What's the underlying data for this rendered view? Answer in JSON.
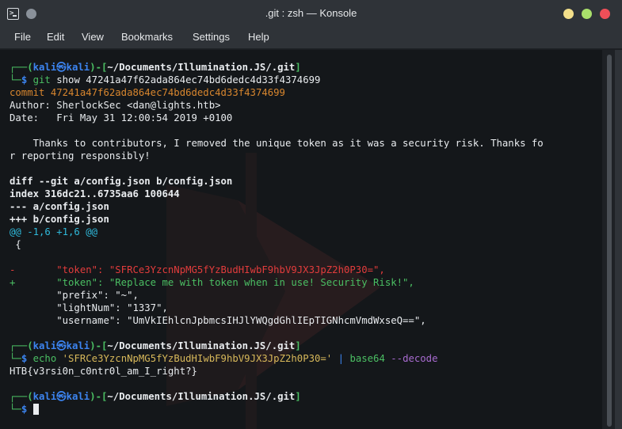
{
  "window": {
    "title": ".git : zsh — Konsole"
  },
  "menu": [
    "File",
    "Edit",
    "View",
    "Bookmarks",
    "Settings",
    "Help"
  ],
  "prompt": {
    "corner_top": "┌──(",
    "user": "kali",
    "at": "㉿",
    "host": "kali",
    "mid": ")-[",
    "path": "~/Documents/Illumination.JS/.git",
    "close": "]",
    "corner_bottom": "└─",
    "symbol": "$"
  },
  "terminal": {
    "cmd1": {
      "name": "git",
      "args": " show 47241a47f62ada864ec74bd6dedc4d33f4374699"
    },
    "commit_line": "commit 47241a47f62ada864ec74bd6dedc4d33f4374699",
    "author_line": "Author: SherlockSec <dan@lights.htb>",
    "date_line": "Date:   Fri May 31 12:00:54 2019 +0100",
    "message_line1": "    Thanks to contributors, I removed the unique token as it was a security risk. Thanks fo",
    "message_line2": "r reporting responsibly!",
    "diff_header": "diff --git a/config.json b/config.json",
    "index_line": "index 316dc21..6735aa6 100644",
    "minus_file": "--- a/config.json",
    "plus_file": "+++ b/config.json",
    "hunk": "@@ -1,6 +1,6 @@",
    "brace": " {",
    "removed_line": "-       \"token\": \"SFRCe3YzcnNpMG5fYzBudHIwbF9hbV9JX3JpZ2h0P30=\",",
    "added_line": "+       \"token\": \"Replace me with token when in use! Security Risk!\",",
    "ctx_prefix": "        \"prefix\": \"~\",",
    "ctx_light": "        \"lightNum\": \"1337\",",
    "ctx_user": "        \"username\": \"UmVkIEhlcnJpbmcsIHJlYWQgdGhlIEpTIGNhcmVmdWxseQ==\",",
    "cmd2": {
      "name": "echo",
      "string": "'SFRCe3YzcnNpMG5fYzBudHIwbF9hbV9JX3JpZ2h0P30='",
      "pipe": "|",
      "prog": "base64",
      "flag": "--decode"
    },
    "output_flag": "HTB{v3rsi0n_c0ntr0l_am_I_right?}"
  }
}
